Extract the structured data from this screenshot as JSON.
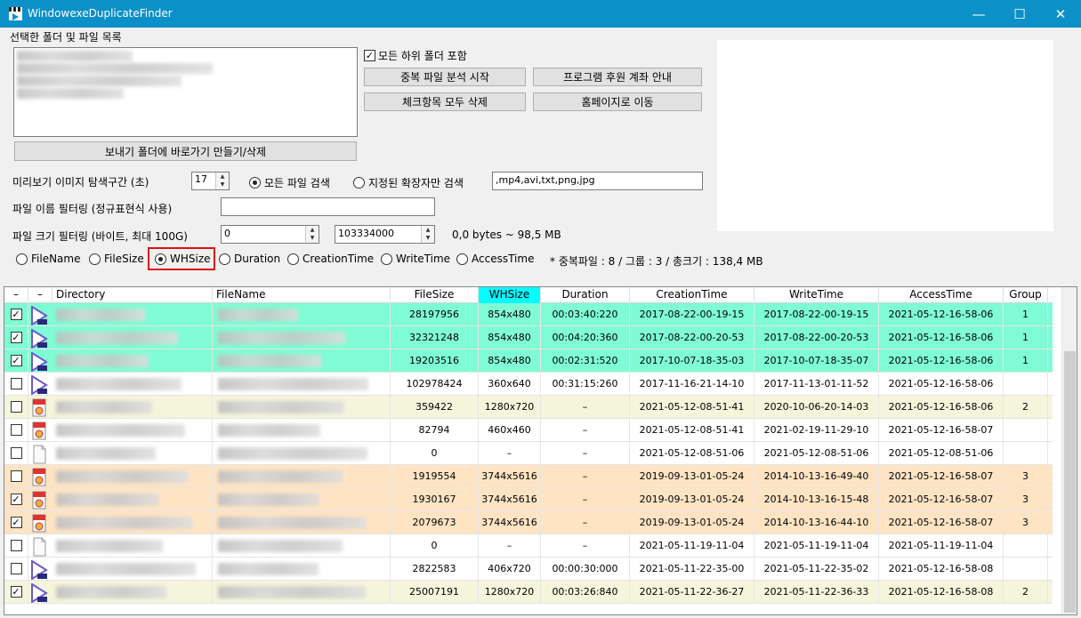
{
  "window": {
    "title": "WindowexeDuplicateFinder",
    "minimize": "—",
    "maximize": "☐",
    "close": "✕"
  },
  "top": {
    "group_label": "선택한 폴더 및 파일 목록",
    "sendto_button": "보내기 폴더에 바로가기 만들기/삭제",
    "subfolder_label": "모든 하위 폴더 포함",
    "analyze_button": "중복 파일 분석 시작",
    "donate_button": "프로그램 후원 계좌 안내",
    "delete_checked_button": "체크항목 모두 삭제",
    "homepage_button": "홈페이지로 이동"
  },
  "options": {
    "preview_label": "미리보기 이미지 탐색구간 (초)",
    "preview_value": "17",
    "all_files_label": "모든 파일 검색",
    "ext_only_label": "지정된 확장자만 검색",
    "ext_value": ",mp4,avi,txt,png,jpg",
    "name_filter_label": "파일 이름 필터링 (정규표현식 사용)",
    "name_filter_value": "",
    "size_filter_label": "파일 크기 필터링 (바이트, 최대 100G)",
    "size_min": "0",
    "size_max": "103334000",
    "size_range_text": "0,0 bytes ~ 98,5 MB"
  },
  "sort": {
    "options": [
      "FileName",
      "FileSize",
      "WHSize",
      "Duration",
      "CreationTime",
      "WriteTime",
      "AccessTime"
    ],
    "selected": "WHSize",
    "summary": "* 중복파일 : 8 / 그룹 : 3 / 총크기 : 138,4 MB"
  },
  "grid": {
    "headers": [
      "–",
      "–",
      "Directory",
      "FileName",
      "FileSize",
      "WHSize",
      "Duration",
      "CreationTime",
      "WriteTime",
      "AccessTime",
      "Group"
    ],
    "rows": [
      {
        "checked": true,
        "icon": "video-file-icon",
        "bg": "#7ffcd4",
        "size": "28197956",
        "wh": "854x480",
        "dur": "00:03:40:220",
        "ctime": "2017-08-22-00-19-15",
        "wtime": "2017-08-22-00-19-15",
        "atime": "2021-05-12-16-58-06",
        "group": "1"
      },
      {
        "checked": true,
        "icon": "video-file-icon",
        "bg": "#7ffcd4",
        "size": "32321248",
        "wh": "854x480",
        "dur": "00:04:20:360",
        "ctime": "2017-08-22-00-20-53",
        "wtime": "2017-08-22-00-20-53",
        "atime": "2021-05-12-16-58-06",
        "group": "1"
      },
      {
        "checked": true,
        "icon": "video-file-icon",
        "bg": "#7ffcd4",
        "size": "19203516",
        "wh": "854x480",
        "dur": "00:02:31:520",
        "ctime": "2017-10-07-18-35-03",
        "wtime": "2017-10-07-18-35-07",
        "atime": "2021-05-12-16-58-06",
        "group": "1"
      },
      {
        "checked": false,
        "icon": "video-file-icon",
        "bg": "#ffffff",
        "size": "102978424",
        "wh": "360x640",
        "dur": "00:31:15:260",
        "ctime": "2017-11-16-21-14-10",
        "wtime": "2017-11-13-01-11-52",
        "atime": "2021-05-12-16-58-06",
        "group": ""
      },
      {
        "checked": false,
        "icon": "image-file-icon",
        "bg": "#f5f5dc",
        "size": "359422",
        "wh": "1280x720",
        "dur": "–",
        "ctime": "2021-05-12-08-51-41",
        "wtime": "2020-10-06-20-14-03",
        "atime": "2021-05-12-16-58-06",
        "group": "2"
      },
      {
        "checked": false,
        "icon": "image-file-icon",
        "bg": "#ffffff",
        "size": "82794",
        "wh": "460x460",
        "dur": "–",
        "ctime": "2021-05-12-08-51-41",
        "wtime": "2021-02-19-11-29-10",
        "atime": "2021-05-12-16-58-07",
        "group": ""
      },
      {
        "checked": false,
        "icon": "blank-file-icon",
        "bg": "#ffffff",
        "size": "0",
        "wh": "–",
        "dur": "–",
        "ctime": "2021-05-12-08-51-06",
        "wtime": "2021-05-12-08-51-06",
        "atime": "2021-05-12-08-51-06",
        "group": ""
      },
      {
        "checked": false,
        "icon": "image-file-icon",
        "bg": "#ffe4c4",
        "size": "1919554",
        "wh": "3744x5616",
        "dur": "–",
        "ctime": "2019-09-13-01-05-24",
        "wtime": "2014-10-13-16-49-40",
        "atime": "2021-05-12-16-58-07",
        "group": "3"
      },
      {
        "checked": true,
        "icon": "image-file-icon",
        "bg": "#ffe4c4",
        "size": "1930167",
        "wh": "3744x5616",
        "dur": "–",
        "ctime": "2019-09-13-01-05-24",
        "wtime": "2014-10-13-16-15-48",
        "atime": "2021-05-12-16-58-07",
        "group": "3"
      },
      {
        "checked": true,
        "icon": "image-file-icon",
        "bg": "#ffe4c4",
        "size": "2079673",
        "wh": "3744x5616",
        "dur": "–",
        "ctime": "2019-09-13-01-05-24",
        "wtime": "2014-10-13-16-44-10",
        "atime": "2021-05-12-16-58-07",
        "group": "3"
      },
      {
        "checked": false,
        "icon": "blank-file-icon",
        "bg": "#ffffff",
        "size": "0",
        "wh": "–",
        "dur": "–",
        "ctime": "2021-05-11-19-11-04",
        "wtime": "2021-05-11-19-11-04",
        "atime": "2021-05-11-19-11-04",
        "group": ""
      },
      {
        "checked": false,
        "icon": "video-file-icon",
        "bg": "#ffffff",
        "size": "2822583",
        "wh": "406x720",
        "dur": "00:00:30:000",
        "ctime": "2021-05-11-22-35-00",
        "wtime": "2021-05-11-22-35-02",
        "atime": "2021-05-12-16-58-08",
        "group": ""
      },
      {
        "checked": true,
        "icon": "video-file-icon",
        "bg": "#f5f5dc",
        "size": "25007191",
        "wh": "1280x720",
        "dur": "00:03:26:840",
        "ctime": "2021-05-11-22-36-27",
        "wtime": "2021-05-11-22-36-33",
        "atime": "2021-05-12-16-58-08",
        "group": "2"
      }
    ]
  },
  "colors": {
    "titlebar": "#0c90c8",
    "group1": "#7ffcd4",
    "group2": "#f5f5dc",
    "group3": "#ffe4c4",
    "sort_highlight": "#00ffff",
    "selected_outline": "#e01010"
  }
}
